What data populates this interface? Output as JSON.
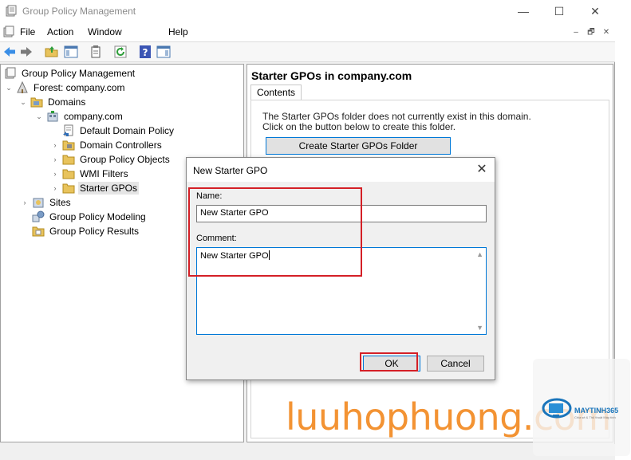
{
  "window": {
    "title": "Group Policy Management"
  },
  "menu": [
    "File",
    "Action",
    "Window",
    "Help"
  ],
  "mdi_buttons": [
    "–",
    "🗗",
    "✕"
  ],
  "tree": {
    "items": [
      {
        "label": "Group Policy Management",
        "icon": "gpm-icon"
      },
      {
        "label": "Forest: company.com",
        "icon": "forest-icon",
        "expanded": true
      },
      {
        "label": "Domains",
        "icon": "folder-icon",
        "expanded": true
      },
      {
        "label": "company.com",
        "icon": "domain-icon",
        "expanded": true
      },
      {
        "label": "Default Domain Policy",
        "icon": "gpo-link-icon"
      },
      {
        "label": "Domain Controllers",
        "icon": "ou-folder-icon",
        "expanded": false
      },
      {
        "label": "Group Policy Objects",
        "icon": "folder-icon",
        "expanded": false
      },
      {
        "label": "WMI Filters",
        "icon": "folder-icon",
        "expanded": false
      },
      {
        "label": "Starter GPOs",
        "icon": "folder-icon",
        "expanded": false,
        "selected": true
      },
      {
        "label": "Sites",
        "icon": "sites-icon",
        "expanded": false
      },
      {
        "label": "Group Policy Modeling",
        "icon": "modeling-icon"
      },
      {
        "label": "Group Policy Results",
        "icon": "results-icon"
      }
    ]
  },
  "right_pane": {
    "title": "Starter GPOs in company.com",
    "tab": "Contents",
    "message_line1": "The Starter GPOs folder does not currently exist in this domain.",
    "message_line2": "Click on the button below to create this folder.",
    "create_button": "Create Starter GPOs Folder"
  },
  "dialog": {
    "title": "New Starter GPO",
    "name_label": "Name:",
    "name_value": "New Starter GPO",
    "comment_label": "Comment:",
    "comment_value": "New Starter GPO",
    "ok_label": "OK",
    "cancel_label": "Cancel"
  },
  "watermark": {
    "text": "luuhophuong.com",
    "logo_text": "MAYTINH365",
    "logo_sub": "Chia sẻ & Thủ thuật Máy tính"
  },
  "colors": {
    "highlight": "#d41f26",
    "accent": "#0078d7",
    "watermark": "#f28a22"
  }
}
